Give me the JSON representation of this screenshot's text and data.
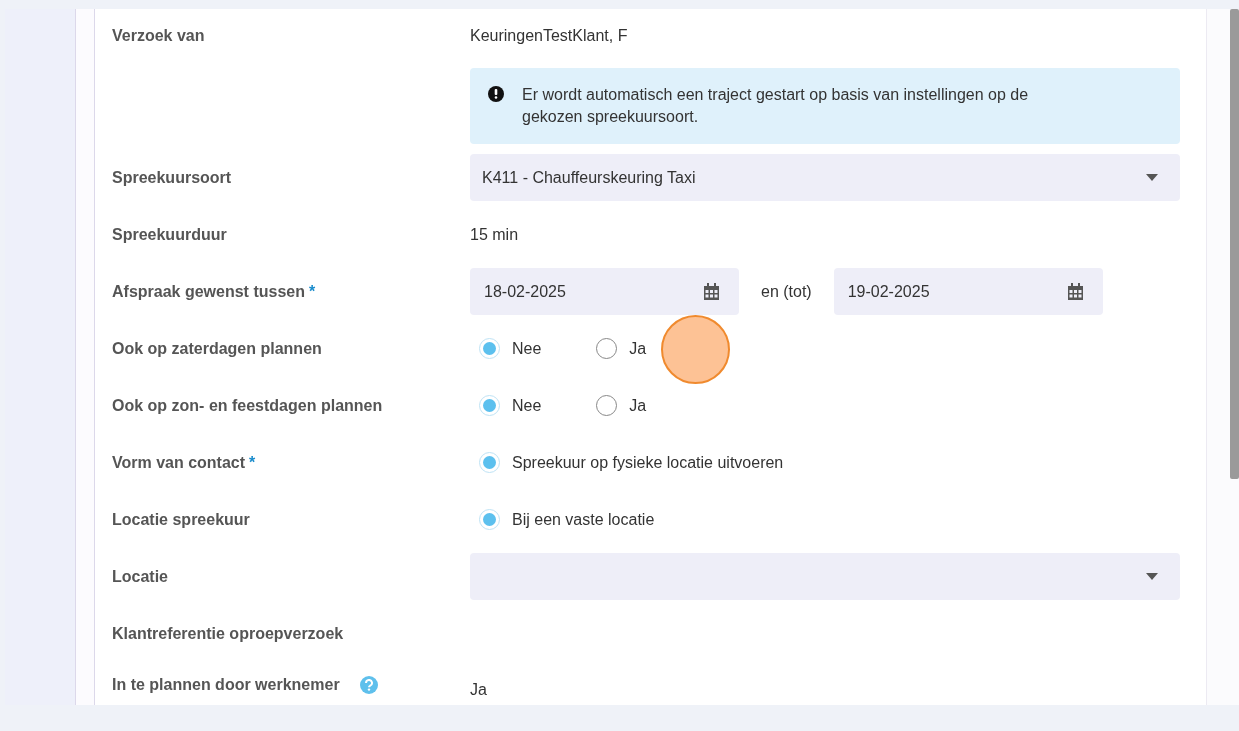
{
  "fields": [
    {
      "kind": "text",
      "label": "Verzoek van",
      "value": "KeuringenTestKlant, F"
    },
    {
      "kind": "notice",
      "text": "Er wordt automatisch een traject gestart op basis van instellingen op de gekozen spreekuursoort."
    },
    {
      "kind": "select",
      "label": "Spreekuursoort",
      "value": "K411 - Chauffeurskeuring Taxi"
    },
    {
      "kind": "text",
      "label": "Spreekuurduur",
      "value": "15 min"
    },
    {
      "kind": "daterange",
      "label": "Afspraak gewenst tussen",
      "required_mark": "*",
      "from": "18-02-2025",
      "between": "en (tot)",
      "to": "19-02-2025"
    },
    {
      "kind": "radio",
      "label": "Ook op zaterdagen plannen",
      "options": [
        {
          "label": "Nee",
          "selected": true
        },
        {
          "label": "Ja",
          "selected": false
        }
      ]
    },
    {
      "kind": "radio",
      "label": "Ook op zon- en feestdagen plannen",
      "options": [
        {
          "label": "Nee",
          "selected": true
        },
        {
          "label": "Ja",
          "selected": false
        }
      ]
    },
    {
      "kind": "radio",
      "label": "Vorm van contact",
      "required_mark": "*",
      "options": [
        {
          "label": "Spreekuur op fysieke locatie uitvoeren",
          "selected": true
        }
      ]
    },
    {
      "kind": "radio",
      "label": "Locatie spreekuur",
      "options": [
        {
          "label": "Bij een vaste locatie",
          "selected": true
        }
      ]
    },
    {
      "kind": "select",
      "label": "Locatie"
    },
    {
      "kind": "text",
      "label": "Klantreferentie oproepverzoek"
    },
    {
      "kind": "text",
      "label": "In te plannen door werknemer",
      "help": true,
      "value": "Ja"
    }
  ]
}
